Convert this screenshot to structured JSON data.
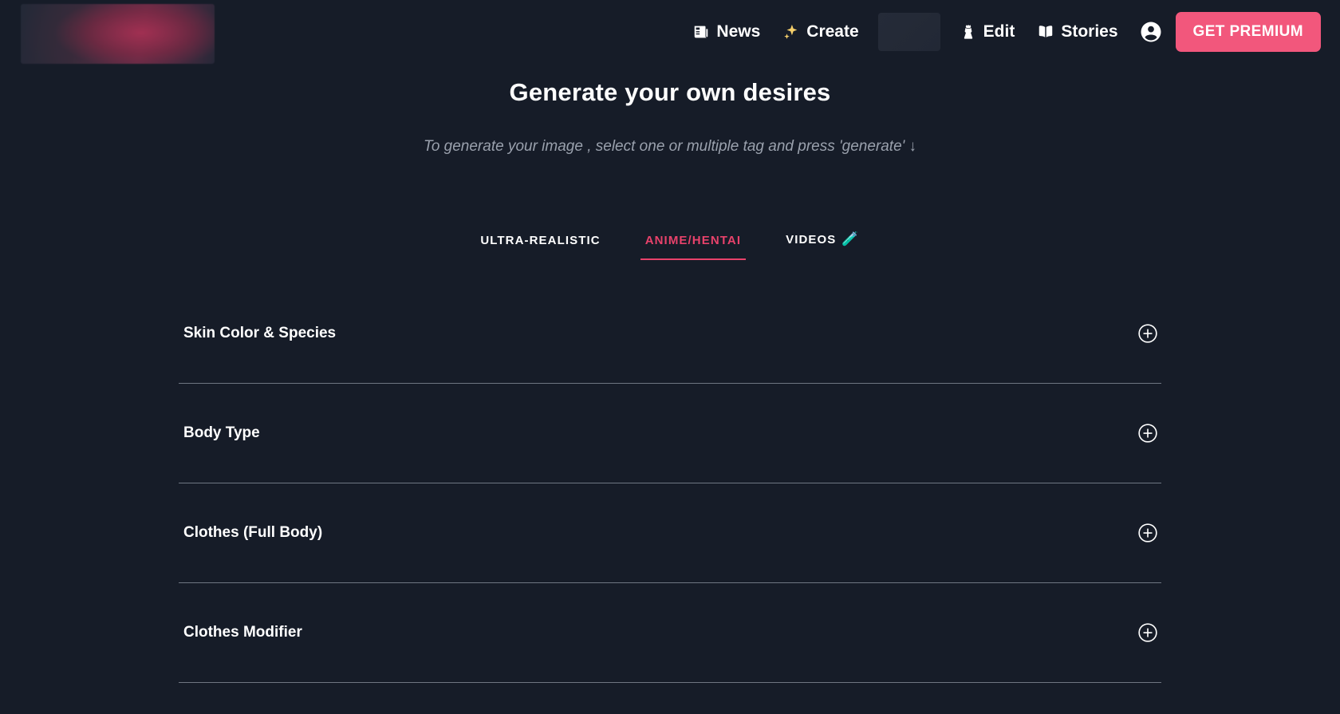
{
  "brand": {
    "logo_alt": "site-logo"
  },
  "nav": {
    "items": [
      {
        "label": "News",
        "icon": "newspaper-icon"
      },
      {
        "label": "Create",
        "icon": "sparkles-icon"
      },
      {
        "label": "Edit",
        "icon": "dress-icon"
      },
      {
        "label": "Stories",
        "icon": "open-book-icon"
      }
    ],
    "account_icon": "account-circle-icon",
    "premium_label": "GET PREMIUM"
  },
  "hero": {
    "title": "Generate your own desires",
    "subtitle": "To generate your image , select one or multiple tag and press 'generate' ↓"
  },
  "tabs": [
    {
      "label": "ULTRA-REALISTIC",
      "active": false,
      "emoji": ""
    },
    {
      "label": "ANIME/HENTAI",
      "active": true,
      "emoji": ""
    },
    {
      "label": "VIDEOS",
      "active": false,
      "emoji": "🧪"
    }
  ],
  "sections": [
    {
      "title": "Skin Color & Species"
    },
    {
      "title": "Body Type"
    },
    {
      "title": "Clothes (Full Body)"
    },
    {
      "title": "Clothes Modifier"
    }
  ],
  "colors": {
    "background": "#161c28",
    "accent_pink": "#e8426b",
    "premium_button": "#f2577c",
    "text_primary": "#ffffff",
    "text_muted": "#9aa1ad",
    "divider": "#6f7682"
  }
}
